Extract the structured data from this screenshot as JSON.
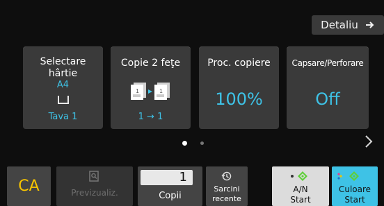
{
  "header": {
    "detail_label": "Detaliu"
  },
  "tiles": [
    {
      "title": "Selectare hârtie",
      "value": "A4",
      "tray": "Tava 1"
    },
    {
      "title": "Copie 2 feţe",
      "mode": "1 → 1"
    },
    {
      "title": "Proc. copiere",
      "value": "100%"
    },
    {
      "title": "Capsare/Perforare",
      "value": "Off"
    }
  ],
  "pager": {
    "page": 1,
    "total": 2
  },
  "bottom": {
    "ca_label": "CA",
    "preview_label": "Previzualiz.",
    "copies_value": "1",
    "copies_label": "Copii",
    "recent_label_line1": "Sarcini",
    "recent_label_line2": "recente",
    "bw_label_line1": "A/N",
    "bw_label_line2": "Start",
    "color_label_line1": "Culoare",
    "color_label_line2": "Start"
  },
  "colors": {
    "accent": "#3ec2e6",
    "ca": "#f7c400",
    "color_start_bg": "#3ec2e6",
    "start_icon": "#5fcf3a"
  },
  "icons": [
    "arrow-right-icon",
    "paper-tray-icon",
    "duplex-copy-icon",
    "chevron-right-icon",
    "preview-icon",
    "history-icon",
    "start-diamond-icon"
  ]
}
